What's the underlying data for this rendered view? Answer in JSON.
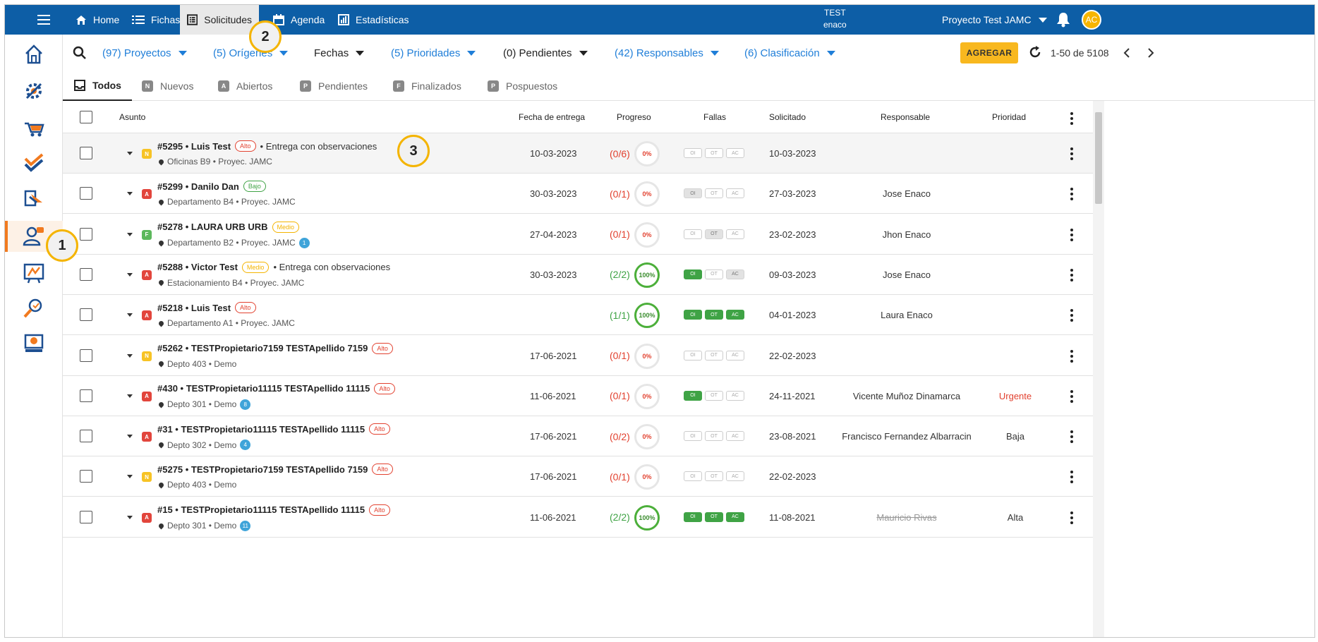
{
  "topbar": {
    "nav": [
      {
        "label": "Home",
        "icon": "home-icon"
      },
      {
        "label": "Fichas",
        "icon": "list-icon"
      },
      {
        "label": "Solicitudes",
        "icon": "table-icon"
      },
      {
        "label": "Agenda",
        "icon": "calendar-icon"
      },
      {
        "label": "Estadísticas",
        "icon": "bar-chart-icon"
      }
    ],
    "test_line1": "TEST",
    "test_line2": "enaco",
    "project": "Proyecto Test JAMC",
    "avatar": "AC"
  },
  "filters": [
    {
      "label": "(97) Proyectos",
      "style": "blue"
    },
    {
      "label": "(5) Orígenes",
      "style": "blue"
    },
    {
      "label": "Fechas",
      "style": "dark"
    },
    {
      "label": "(5) Prioridades",
      "style": "blue"
    },
    {
      "label": "(0) Pendientes",
      "style": "dark"
    },
    {
      "label": "(42) Responsables",
      "style": "blue"
    },
    {
      "label": "(6) Clasificación",
      "style": "blue"
    }
  ],
  "actions": {
    "add_label": "AGREGAR",
    "pager": "1-50 de 5108"
  },
  "tabs": [
    {
      "label": "Todos",
      "badge": ""
    },
    {
      "label": "Nuevos",
      "badge": "N"
    },
    {
      "label": "Abiertos",
      "badge": "A"
    },
    {
      "label": "Pendientes",
      "badge": "P"
    },
    {
      "label": "Finalizados",
      "badge": "F"
    },
    {
      "label": "Pospuestos",
      "badge": "P"
    }
  ],
  "columns": {
    "asunto": "Asunto",
    "fecha": "Fecha de entrega",
    "progreso": "Progreso",
    "fallas": "Fallas",
    "solicitado": "Solicitado",
    "responsable": "Responsable",
    "prioridad": "Prioridad"
  },
  "fallas_labels": [
    "OI",
    "OT",
    "AC"
  ],
  "rows": [
    {
      "status": "N",
      "status_color": "#f7c325",
      "title": "#5295 • Luis Test",
      "tag": "Alto",
      "note": "• Entrega con observaciones",
      "location": "Oficinas B9 • Proyec. JAMC",
      "count": "",
      "date": "10-03-2023",
      "progress": "(0/6)",
      "pct": "0%",
      "fallas": [
        "empty",
        "empty",
        "empty"
      ],
      "solicitado": "10-03-2023",
      "responsable": "",
      "prioridad": "",
      "highlight": true
    },
    {
      "status": "A",
      "status_color": "#e2453c",
      "title": "#5299 • Danilo Dan",
      "tag": "Bajo",
      "note": "",
      "location": "Departamento B4 • Proyec. JAMC",
      "count": "",
      "date": "30-03-2023",
      "progress": "(0/1)",
      "pct": "0%",
      "fallas": [
        "gray",
        "empty",
        "empty"
      ],
      "solicitado": "27-03-2023",
      "responsable": "Jose Enaco",
      "prioridad": ""
    },
    {
      "status": "F",
      "status_color": "#5cb85c",
      "title": "#5278 • LAURA URB URB",
      "tag": "Medio",
      "note": "",
      "location": "Departamento B2 • Proyec. JAMC",
      "count": "1",
      "date": "27-04-2023",
      "progress": "(0/1)",
      "pct": "0%",
      "fallas": [
        "empty",
        "gray",
        "empty"
      ],
      "solicitado": "23-02-2023",
      "responsable": "Jhon Enaco",
      "prioridad": ""
    },
    {
      "status": "A",
      "status_color": "#e2453c",
      "title": "#5288 • Victor Test",
      "tag": "Medio",
      "note": "• Entrega con observaciones",
      "location": "Estacionamiento B4 • Proyec. JAMC",
      "count": "",
      "date": "30-03-2023",
      "progress": "(2/2)",
      "pct": "100%",
      "fallas": [
        "green",
        "empty",
        "gray"
      ],
      "solicitado": "09-03-2023",
      "responsable": "Jose Enaco",
      "prioridad": ""
    },
    {
      "status": "A",
      "status_color": "#e2453c",
      "title": "#5218 • Luis Test",
      "tag": "Alto",
      "note": "",
      "location": "Departamento A1 • Proyec. JAMC",
      "count": "",
      "date": "",
      "progress": "(1/1)",
      "pct": "100%",
      "fallas": [
        "green",
        "green",
        "green"
      ],
      "solicitado": "04-01-2023",
      "responsable": "Laura Enaco",
      "prioridad": ""
    },
    {
      "status": "N",
      "status_color": "#f7c325",
      "title": "#5262 • TESTPropietario7159 TESTApellido 7159",
      "tag": "Alto",
      "note": "",
      "location": "Depto 403 • Demo",
      "count": "",
      "date": "17-06-2021",
      "progress": "(0/1)",
      "pct": "0%",
      "fallas": [
        "empty",
        "empty",
        "empty"
      ],
      "solicitado": "22-02-2023",
      "responsable": "",
      "prioridad": ""
    },
    {
      "status": "A",
      "status_color": "#e2453c",
      "title": "#430 • TESTPropietario11115 TESTApellido 11115",
      "tag": "Alto",
      "note": "",
      "location": "Depto 301 • Demo",
      "count": "8",
      "date": "11-06-2021",
      "progress": "(0/1)",
      "pct": "0%",
      "fallas": [
        "green",
        "empty",
        "empty"
      ],
      "solicitado": "24-11-2021",
      "responsable": "Vicente Muñoz Dinamarca",
      "prioridad": "Urgente"
    },
    {
      "status": "A",
      "status_color": "#e2453c",
      "title": "#31 • TESTPropietario11115 TESTApellido 11115",
      "tag": "Alto",
      "note": "",
      "location": "Depto 302 • Demo",
      "count": "4",
      "date": "17-06-2021",
      "progress": "(0/2)",
      "pct": "0%",
      "fallas": [
        "empty",
        "empty",
        "empty"
      ],
      "solicitado": "23-08-2021",
      "responsable": "Francisco Fernandez Albarracin",
      "prioridad": "Baja"
    },
    {
      "status": "N",
      "status_color": "#f7c325",
      "title": "#5275 • TESTPropietario7159 TESTApellido 7159",
      "tag": "Alto",
      "note": "",
      "location": "Depto 403 • Demo",
      "count": "",
      "date": "17-06-2021",
      "progress": "(0/1)",
      "pct": "0%",
      "fallas": [
        "empty",
        "empty",
        "empty"
      ],
      "solicitado": "22-02-2023",
      "responsable": "",
      "prioridad": ""
    },
    {
      "status": "A",
      "status_color": "#e2453c",
      "title": "#15 • TESTPropietario11115 TESTApellido 11115",
      "tag": "Alto",
      "note": "",
      "location": "Depto 301 • Demo",
      "count": "11",
      "date": "11-06-2021",
      "progress": "(2/2)",
      "pct": "100%",
      "fallas": [
        "green",
        "green",
        "green"
      ],
      "solicitado": "11-08-2021",
      "responsable": "Mauricio Rivas",
      "responsable_strike": true,
      "prioridad": "Alta"
    }
  ],
  "markers": [
    "1",
    "2",
    "3"
  ],
  "colors": {
    "topbar": "#0d5ea6",
    "accent": "#f8b81f",
    "link": "#1f7ed8",
    "danger": "#e2412f",
    "success": "#4caf3a"
  }
}
